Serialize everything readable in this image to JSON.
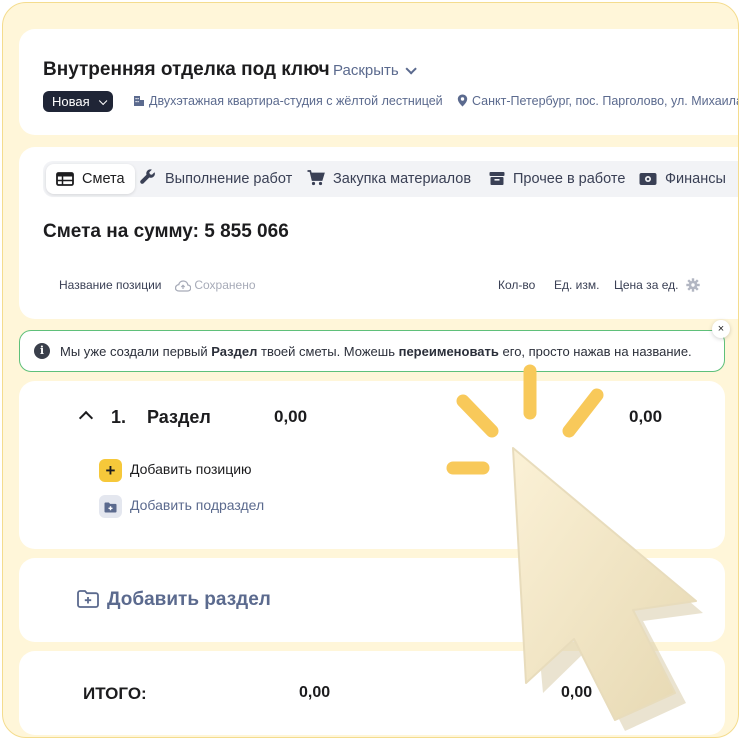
{
  "header": {
    "title": "Внутренняя отделка под ключ",
    "expand_label": "Раскрыть",
    "status": "Новая",
    "building": "Двухэтажная квартира-студия с жёлтой лестницей",
    "location": "Санкт-Петербург, пос. Парголово, ул. Михаила Д"
  },
  "tabs": [
    {
      "label": "Смета",
      "icon": "table-icon",
      "active": true
    },
    {
      "label": "Выполнение работ",
      "icon": "wrench-icon",
      "active": false
    },
    {
      "label": "Закупка материалов",
      "icon": "cart-icon",
      "active": false
    },
    {
      "label": "Прочее в работе",
      "icon": "box-icon",
      "active": false
    },
    {
      "label": "Финансы",
      "icon": "money-icon",
      "active": false
    }
  ],
  "estimate": {
    "sum_title": "Смета на сумму: 5 855 066",
    "columns": {
      "name": "Название позиции",
      "saved": "Сохранено",
      "qty": "Кол-во",
      "unit": "Ед. изм.",
      "price": "Цена за ед."
    }
  },
  "banner": {
    "part1": "Мы уже создали первый ",
    "bold1": "Раздел",
    "part2": " твоей сметы.  Можешь ",
    "bold2": "переименовать",
    "part3": " его, просто нажав на название.",
    "close": "×"
  },
  "section": {
    "number": "1.",
    "name": "Раздел",
    "value1": "0,00",
    "value2": "0,00",
    "add_position": "Добавить позицию",
    "add_subsection": "Добавить подраздел"
  },
  "add_section": "Добавить раздел",
  "total": {
    "label": "ИТОГО:",
    "value1": "0,00",
    "value2": "0,00"
  },
  "colors": {
    "frame_bg": "#fff6d9",
    "accent_yellow": "#f6c83a",
    "banner_border": "#5fc07a",
    "muted_blue": "#5b6a8e",
    "dark": "#1f2536"
  }
}
